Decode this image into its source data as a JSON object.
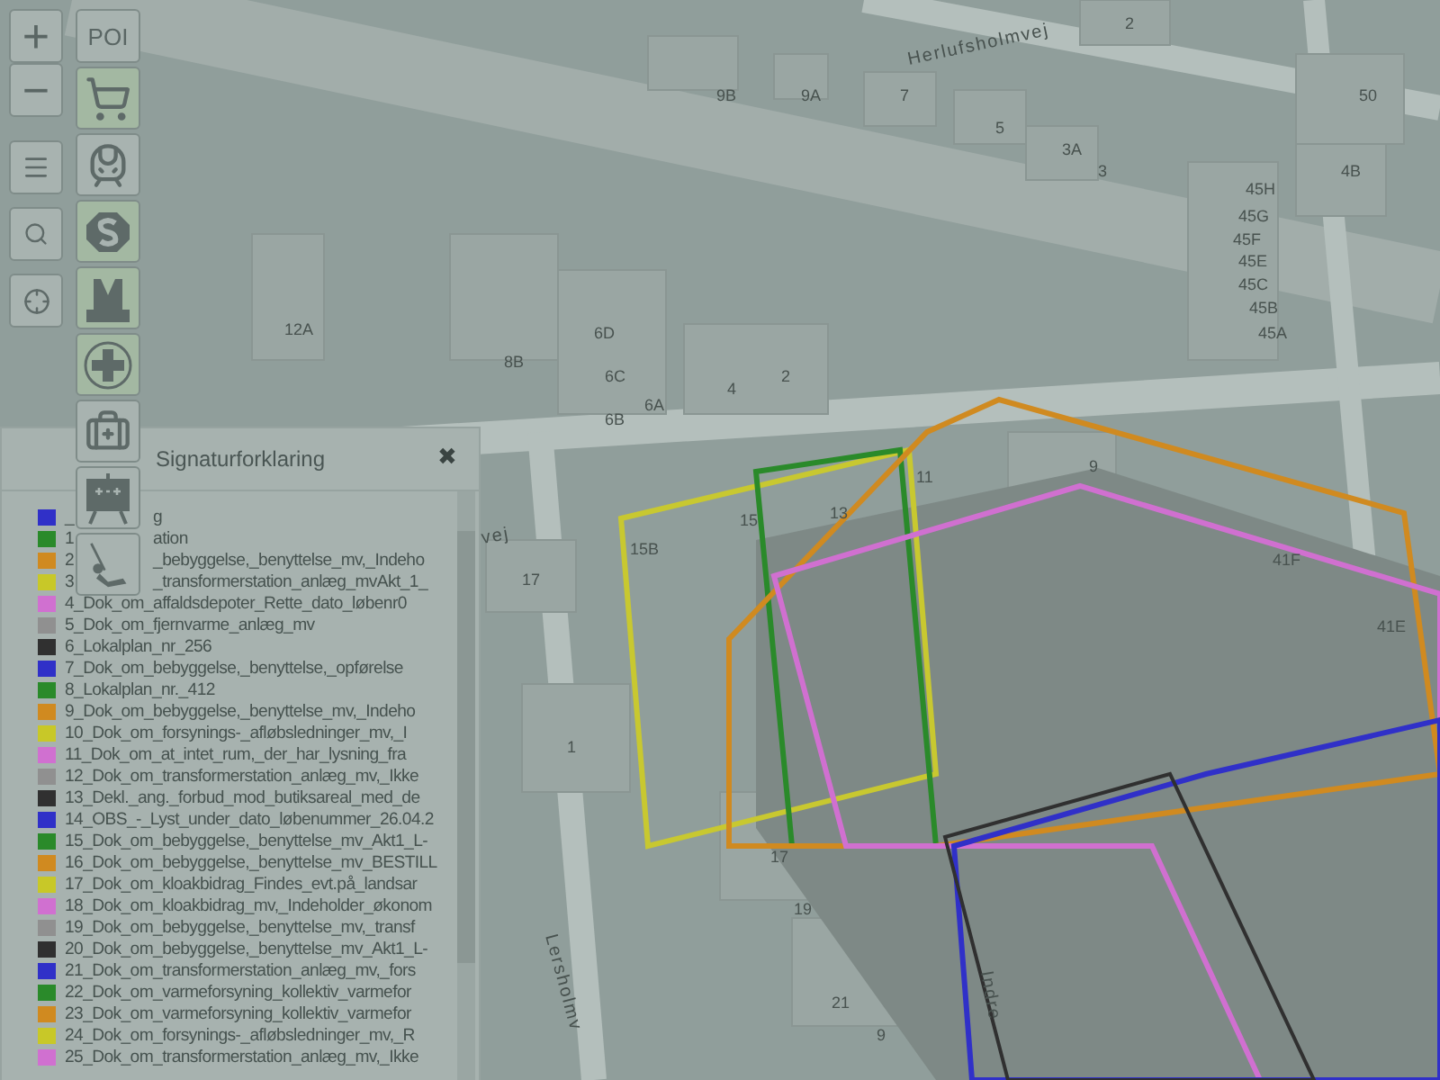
{
  "map": {
    "streets": [
      "Herlufsholmvej",
      "vej",
      "Lersholmv",
      "Indre"
    ],
    "building_numbers": [
      "2",
      "9B",
      "9A",
      "7",
      "50",
      "5",
      "3A",
      "3",
      "4B",
      "45H",
      "45G",
      "45F",
      "45E",
      "45C",
      "45B",
      "12A",
      "6D",
      "45A",
      "8B",
      "6C",
      "2",
      "4",
      "6A",
      "6B",
      "9",
      "11",
      "13",
      "15",
      "15B",
      "41F",
      "17",
      "41E",
      "1",
      "17",
      "19",
      "21",
      "9"
    ]
  },
  "zoom_controls": [
    "+",
    "−"
  ],
  "tools": [
    {
      "kind": "menu"
    },
    {
      "kind": "search"
    },
    {
      "kind": "locate"
    }
  ],
  "poi": {
    "label": "POI",
    "categories": [
      {
        "kind": "cart",
        "on": true
      },
      {
        "kind": "train",
        "on": false
      },
      {
        "kind": "s-train",
        "on": true
      },
      {
        "kind": "metro",
        "on": true
      },
      {
        "kind": "health",
        "on": true
      },
      {
        "kind": "doctor",
        "on": false
      },
      {
        "kind": "school",
        "on": false
      },
      {
        "kind": "playground",
        "on": false
      }
    ]
  },
  "legend": {
    "title": "Signaturforklaring",
    "close": "✖",
    "items": [
      {
        "lead": "_",
        "tail": "g",
        "color": "#3030c8"
      },
      {
        "lead": "1",
        "tail": "ation",
        "color": "#2a8a2a"
      },
      {
        "lead": "2",
        "tail": "_bebyggelse,_benyttelse_mv,_Indeho",
        "color": "#d08a20"
      },
      {
        "lead": "3",
        "tail": "_transformerstation_anlæg_mvAkt_1_",
        "color": "#c8c828"
      },
      {
        "lead": "4_Dok_om_affaldsdepoter_Rette_dato_løbenr0",
        "color": "#d070d0"
      },
      {
        "lead": "5_Dok_om_fjernvarme_anlæg_mv",
        "color": "#909090"
      },
      {
        "lead": "6_Lokalplan_nr_256",
        "color": "#303030"
      },
      {
        "lead": "7_Dok_om_bebyggelse,_benyttelse,_opførelse",
        "color": "#3030c8"
      },
      {
        "lead": "8_Lokalplan_nr._412",
        "color": "#2a8a2a"
      },
      {
        "lead": "9_Dok_om_bebyggelse,_benyttelse_mv,_Indeho",
        "color": "#d08a20"
      },
      {
        "lead": "10_Dok_om_forsynings-_afløbsledninger_mv,_I",
        "color": "#c8c828"
      },
      {
        "lead": "11_Dok_om_at_intet_rum,_der_har_lysning_fra",
        "color": "#d070d0"
      },
      {
        "lead": "12_Dok_om_transformerstation_anlæg_mv,_Ikke",
        "color": "#909090"
      },
      {
        "lead": "13_Dekl._ang._forbud_mod_butiksareal_med_de",
        "color": "#303030"
      },
      {
        "lead": "14_OBS_-_Lyst_under_dato_løbenummer_26.04.2",
        "color": "#3030c8"
      },
      {
        "lead": "15_Dok_om_bebyggelse,_benyttelse_mv_Akt1_L-",
        "color": "#2a8a2a"
      },
      {
        "lead": "16_Dok_om_bebyggelse,_benyttelse_mv_BESTILL",
        "color": "#d08a20"
      },
      {
        "lead": "17_Dok_om_kloakbidrag_Findes_evt.på_landsar",
        "color": "#c8c828"
      },
      {
        "lead": "18_Dok_om_kloakbidrag_mv,_Indeholder_økonom",
        "color": "#d070d0"
      },
      {
        "lead": "19_Dok_om_bebyggelse,_benyttelse_mv,_transf",
        "color": "#909090"
      },
      {
        "lead": "20_Dok_om_bebyggelse,_benyttelse_mv_Akt1_L-",
        "color": "#303030"
      },
      {
        "lead": "21_Dok_om_transformerstation_anlæg_mv,_fors",
        "color": "#3030c8"
      },
      {
        "lead": "22_Dok_om_varmeforsyning_kollektiv_varmefor",
        "color": "#2a8a2a"
      },
      {
        "lead": "23_Dok_om_varmeforsyning_kollektiv_varmefor",
        "color": "#d08a20"
      },
      {
        "lead": "24_Dok_om_forsynings-_afløbsledninger_mv,_R",
        "color": "#c8c828"
      },
      {
        "lead": "25_Dok_om_transformerstation_anlæg_mv,_Ikke",
        "color": "#d070d0"
      }
    ]
  }
}
